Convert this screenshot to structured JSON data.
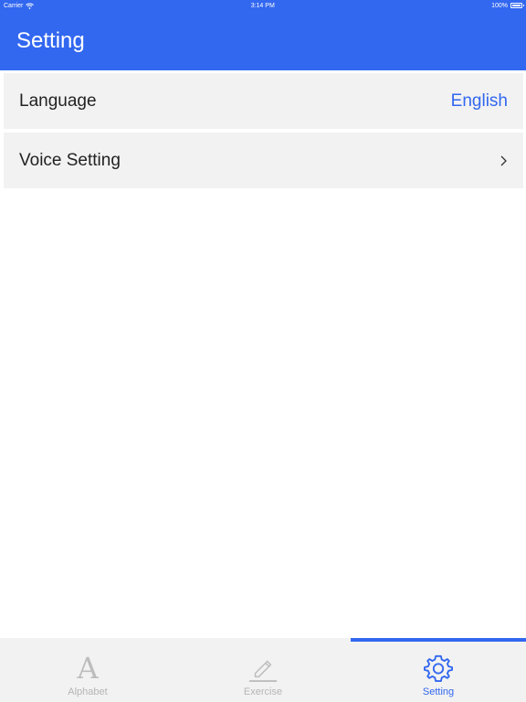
{
  "status_bar": {
    "carrier": "Carrier",
    "time": "3:14 PM",
    "battery": "100%"
  },
  "nav": {
    "title": "Setting"
  },
  "settings": {
    "language_label": "Language",
    "language_value": "English",
    "voice_label": "Voice Setting"
  },
  "tabs": [
    {
      "label": "Alphabet",
      "icon": "letter-a-icon",
      "glyph": "A"
    },
    {
      "label": "Exercise",
      "icon": "pencil-icon"
    },
    {
      "label": "Setting",
      "icon": "gear-icon"
    }
  ],
  "colors": {
    "accent": "#3267f0",
    "inactive_tab": "#b5b5b5",
    "row_background": "#f2f2f2"
  }
}
